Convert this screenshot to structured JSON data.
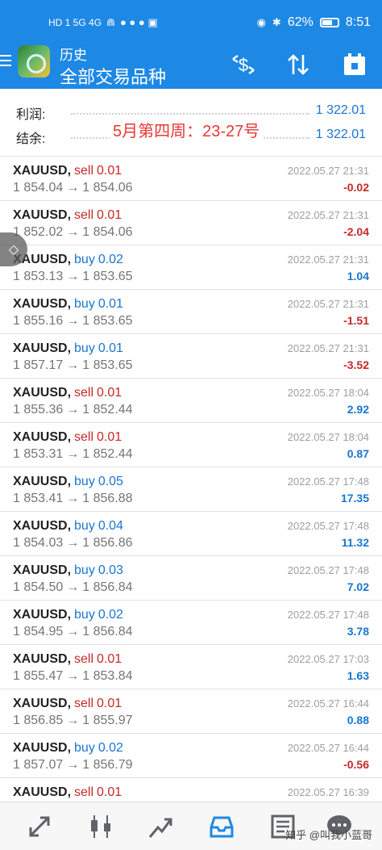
{
  "status_bar": {
    "left_indicators": "HD 1  5G  4G",
    "battery": "62%",
    "time": "8:51"
  },
  "toolbar": {
    "title": "历史",
    "subtitle": "全部交易品种",
    "icons": [
      "menu-icon",
      "app-logo",
      "currency-exchange-icon",
      "sort-icon",
      "calendar-icon"
    ]
  },
  "summary": {
    "profit_label": "利润:",
    "profit_value": "1 322.01",
    "balance_label": "结余:",
    "balance_value": "1 322.01",
    "annotation": "5月第四周：23-27号"
  },
  "trades": [
    {
      "symbol": "XAUUSD,",
      "side": "sell",
      "volume": "0.01",
      "open": "1 854.04",
      "close": "1 854.06",
      "time": "2022.05.27 21:31",
      "profit": "-0.02"
    },
    {
      "symbol": "XAUUSD,",
      "side": "sell",
      "volume": "0.01",
      "open": "1 852.02",
      "close": "1 854.06",
      "time": "2022.05.27 21:31",
      "profit": "-2.04"
    },
    {
      "symbol": "XAUUSD,",
      "side": "buy",
      "volume": "0.02",
      "open": "1 853.13",
      "close": "1 853.65",
      "time": "2022.05.27 21:31",
      "profit": "1.04"
    },
    {
      "symbol": "XAUUSD,",
      "side": "buy",
      "volume": "0.01",
      "open": "1 855.16",
      "close": "1 853.65",
      "time": "2022.05.27 21:31",
      "profit": "-1.51"
    },
    {
      "symbol": "XAUUSD,",
      "side": "buy",
      "volume": "0.01",
      "open": "1 857.17",
      "close": "1 853.65",
      "time": "2022.05.27 21:31",
      "profit": "-3.52"
    },
    {
      "symbol": "XAUUSD,",
      "side": "sell",
      "volume": "0.01",
      "open": "1 855.36",
      "close": "1 852.44",
      "time": "2022.05.27 18:04",
      "profit": "2.92"
    },
    {
      "symbol": "XAUUSD,",
      "side": "sell",
      "volume": "0.01",
      "open": "1 853.31",
      "close": "1 852.44",
      "time": "2022.05.27 18:04",
      "profit": "0.87"
    },
    {
      "symbol": "XAUUSD,",
      "side": "buy",
      "volume": "0.05",
      "open": "1 853.41",
      "close": "1 856.88",
      "time": "2022.05.27 17:48",
      "profit": "17.35"
    },
    {
      "symbol": "XAUUSD,",
      "side": "buy",
      "volume": "0.04",
      "open": "1 854.03",
      "close": "1 856.86",
      "time": "2022.05.27 17:48",
      "profit": "11.32"
    },
    {
      "symbol": "XAUUSD,",
      "side": "buy",
      "volume": "0.03",
      "open": "1 854.50",
      "close": "1 856.84",
      "time": "2022.05.27 17:48",
      "profit": "7.02"
    },
    {
      "symbol": "XAUUSD,",
      "side": "buy",
      "volume": "0.02",
      "open": "1 854.95",
      "close": "1 856.84",
      "time": "2022.05.27 17:48",
      "profit": "3.78"
    },
    {
      "symbol": "XAUUSD,",
      "side": "sell",
      "volume": "0.01",
      "open": "1 855.47",
      "close": "1 853.84",
      "time": "2022.05.27 17:03",
      "profit": "1.63"
    },
    {
      "symbol": "XAUUSD,",
      "side": "sell",
      "volume": "0.01",
      "open": "1 856.85",
      "close": "1 855.97",
      "time": "2022.05.27 16:44",
      "profit": "0.88"
    },
    {
      "symbol": "XAUUSD,",
      "side": "buy",
      "volume": "0.02",
      "open": "1 857.07",
      "close": "1 856.79",
      "time": "2022.05.27 16:44",
      "profit": "-0.56"
    },
    {
      "symbol": "XAUUSD,",
      "side": "sell",
      "volume": "0.01",
      "open": "",
      "close": "",
      "time": "2022.05.27 16:39",
      "profit": ""
    }
  ],
  "arrow": "→",
  "bottom_nav": {
    "items": [
      "quotes-icon",
      "chart-icon",
      "trade-icon",
      "history-icon",
      "news-icon",
      "chat-icon"
    ],
    "active": "history-icon",
    "watermark": "知乎 @叫我小蓝哥"
  },
  "colors": {
    "primary": "#1e88e5",
    "sell": "#c62828",
    "buy": "#1976d2",
    "loss": "#c62828",
    "gain": "#1976d2"
  }
}
